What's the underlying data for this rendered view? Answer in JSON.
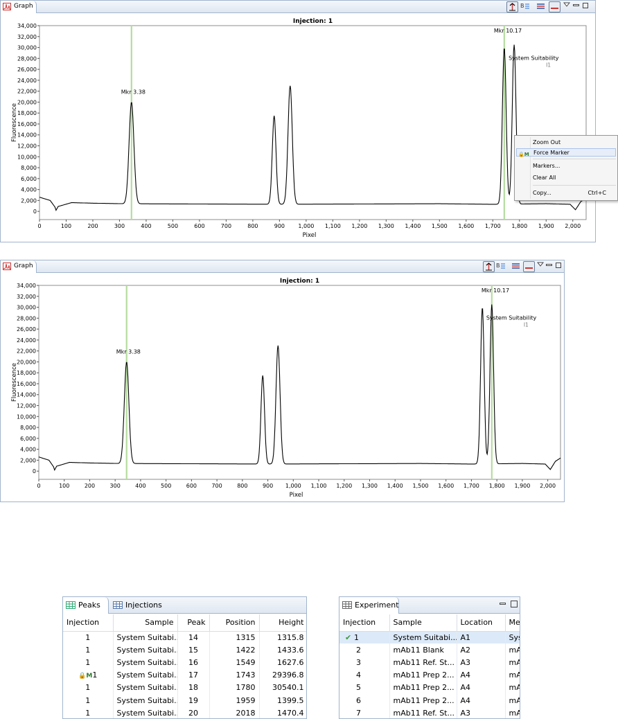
{
  "graph_panels": [
    {
      "tab_label": "Graph",
      "title": "Injection: 1",
      "ylabel": "Fluorescence",
      "xlabel": "Pixel",
      "markers": [
        {
          "label": "Mkr 3.38",
          "x": 345
        },
        {
          "label": "Mkr 10.17",
          "x": 1743
        }
      ],
      "annotation": {
        "label": "System Suitability",
        "sub_label": "I1",
        "x": 1780
      }
    },
    {
      "tab_label": "Graph",
      "title": "Injection: 1",
      "ylabel": "Fluorescence",
      "xlabel": "Pixel",
      "markers": [
        {
          "label": "Mkr 3.38",
          "x": 345
        },
        {
          "label": "Mkr 10.17",
          "x": 1780
        }
      ],
      "annotation": {
        "label": "System Suitability",
        "sub_label": "I1",
        "x": 1780
      }
    }
  ],
  "chart_data": {
    "type": "line",
    "title": "Injection: 1",
    "xlabel": "Pixel",
    "ylabel": "Fluorescence",
    "xlim": [
      0,
      2050
    ],
    "ylim": [
      -1500,
      34000
    ],
    "x_ticks": [
      "0",
      "100",
      "200",
      "300",
      "400",
      "500",
      "600",
      "700",
      "800",
      "900",
      "1,000",
      "1,100",
      "1,200",
      "1,300",
      "1,400",
      "1,500",
      "1,600",
      "1,700",
      "1,800",
      "1,900",
      "2,000"
    ],
    "y_ticks": [
      "34,000",
      "32,000",
      "30,000",
      "28,000",
      "26,000",
      "24,000",
      "22,000",
      "20,000",
      "18,000",
      "16,000",
      "14,000",
      "12,000",
      "10,000",
      "8,000",
      "6,000",
      "4,000",
      "2,000",
      "0"
    ],
    "grid": false,
    "series": [
      {
        "baseline": [
          [
            0,
            2600
          ],
          [
            40,
            2000
          ],
          [
            58,
            800
          ],
          [
            62,
            200
          ],
          [
            70,
            900
          ],
          [
            120,
            1600
          ],
          [
            200,
            1500
          ],
          [
            320,
            1400
          ],
          [
            900,
            1300
          ],
          [
            1500,
            1400
          ],
          [
            1700,
            1300
          ],
          [
            1900,
            1400
          ],
          [
            1990,
            1300
          ],
          [
            2010,
            300
          ],
          [
            2030,
            1800
          ],
          [
            2050,
            2400
          ]
        ],
        "peaks": [
          {
            "x": 345,
            "height": 20000,
            "width": 9
          },
          {
            "x": 880,
            "height": 17500,
            "width": 7
          },
          {
            "x": 940,
            "height": 23000,
            "width": 8
          },
          {
            "x": 1743,
            "height": 30000,
            "width": 7
          },
          {
            "x": 1780,
            "height": 30500,
            "width": 7
          }
        ]
      }
    ]
  },
  "context_menu": {
    "items": [
      {
        "label": "Zoom Out",
        "shortcut": ""
      },
      {
        "label": "Force Marker",
        "shortcut": "",
        "icon": "lock-marker-icon"
      },
      {
        "label": "Markers...",
        "shortcut": ""
      },
      {
        "label": "Clear All",
        "shortcut": ""
      },
      {
        "label": "Copy...",
        "shortcut": "Ctrl+C"
      }
    ]
  },
  "peaks_view": {
    "tabs": [
      "Peaks",
      "Injections"
    ],
    "columns": [
      "Injection",
      "Sample",
      "Peak",
      "Position",
      "Height"
    ],
    "marker_badge": "M",
    "rows": [
      {
        "injection": "1",
        "sample": "System Suitabi...",
        "peak": "14",
        "position": "1315",
        "height": "1315.8",
        "marked": false
      },
      {
        "injection": "1",
        "sample": "System Suitabi...",
        "peak": "15",
        "position": "1422",
        "height": "1433.6",
        "marked": false
      },
      {
        "injection": "1",
        "sample": "System Suitabi...",
        "peak": "16",
        "position": "1549",
        "height": "1627.6",
        "marked": false
      },
      {
        "injection": "1",
        "sample": "System Suitabi...",
        "peak": "17",
        "position": "1743",
        "height": "29396.8",
        "marked": true
      },
      {
        "injection": "1",
        "sample": "System Suitabi...",
        "peak": "18",
        "position": "1780",
        "height": "30540.1",
        "marked": false
      },
      {
        "injection": "1",
        "sample": "System Suitabi...",
        "peak": "19",
        "position": "1959",
        "height": "1399.5",
        "marked": false
      },
      {
        "injection": "1",
        "sample": "System Suitabi...",
        "peak": "20",
        "position": "2018",
        "height": "1470.4",
        "marked": false
      }
    ]
  },
  "experiment_view": {
    "tab": "Experiment",
    "columns": [
      "Injection",
      "Sample",
      "Location",
      "Me"
    ],
    "rows": [
      {
        "injection": "1",
        "sample": "System Suitabi...",
        "location": "A1",
        "method": "Sys",
        "selected": true
      },
      {
        "injection": "2",
        "sample": "mAb11 Blank",
        "location": "A2",
        "method": "mA",
        "selected": false
      },
      {
        "injection": "3",
        "sample": "mAb11 Ref. St...",
        "location": "A3",
        "method": "mA",
        "selected": false
      },
      {
        "injection": "4",
        "sample": "mAb11 Prep 2...",
        "location": "A4",
        "method": "mA",
        "selected": false
      },
      {
        "injection": "5",
        "sample": "mAb11 Prep 2...",
        "location": "A4",
        "method": "mA",
        "selected": false
      },
      {
        "injection": "6",
        "sample": "mAb11 Prep 2...",
        "location": "A4",
        "method": "mA",
        "selected": false
      },
      {
        "injection": "7",
        "sample": "mAb11 Ref. St...",
        "location": "A3",
        "method": "mA",
        "selected": false
      }
    ]
  },
  "colors": {
    "trace": "#000000",
    "marker_line": "#b5dca0",
    "selection": "#dce9f8",
    "mark_green": "#2c7a2c"
  }
}
